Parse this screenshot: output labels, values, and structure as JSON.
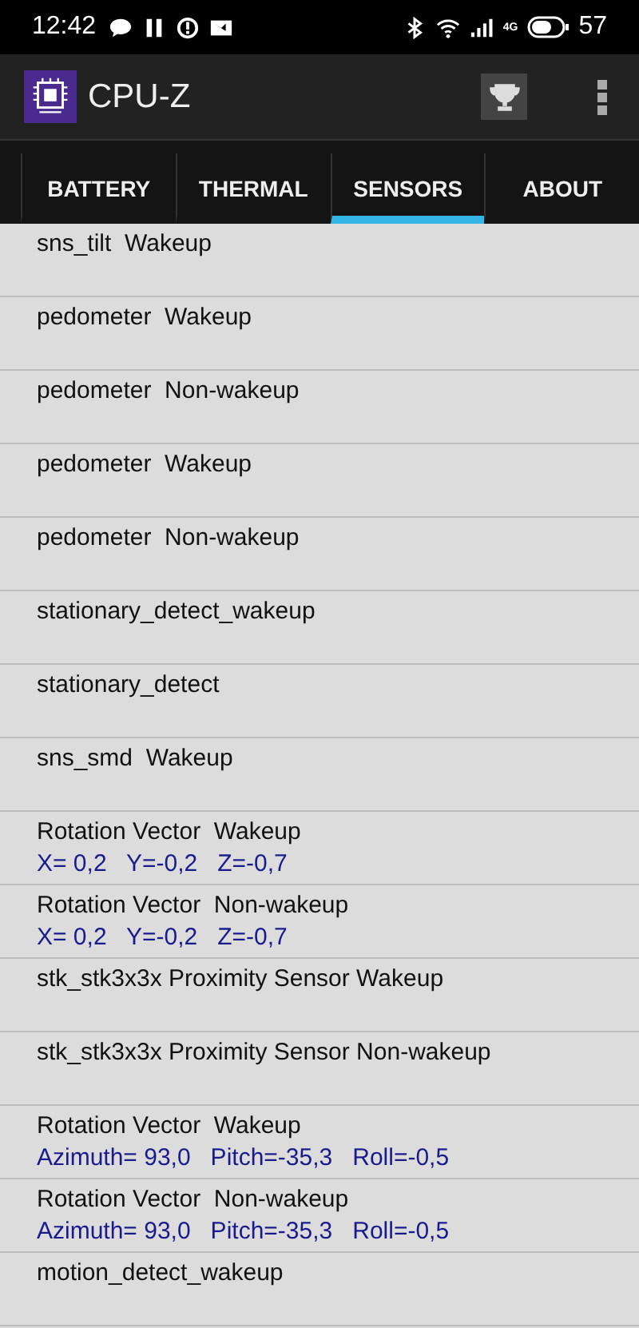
{
  "status_bar": {
    "time": "12:42",
    "battery": "57",
    "network": "4G"
  },
  "app_bar": {
    "title": "CPU-Z"
  },
  "tabs": [
    {
      "label": "BATTERY",
      "selected": false
    },
    {
      "label": "THERMAL",
      "selected": false
    },
    {
      "label": "SENSORS",
      "selected": true
    },
    {
      "label": "ABOUT",
      "selected": false
    }
  ],
  "sensors": [
    {
      "name": "sns_tilt  Wakeup"
    },
    {
      "name": "pedometer  Wakeup"
    },
    {
      "name": "pedometer  Non-wakeup"
    },
    {
      "name": "pedometer  Wakeup"
    },
    {
      "name": "pedometer  Non-wakeup"
    },
    {
      "name": "stationary_detect_wakeup"
    },
    {
      "name": "stationary_detect"
    },
    {
      "name": "sns_smd  Wakeup"
    },
    {
      "name": "Rotation Vector  Wakeup",
      "value": "X= 0,2   Y=-0,2   Z=-0,7"
    },
    {
      "name": "Rotation Vector  Non-wakeup",
      "value": "X= 0,2   Y=-0,2   Z=-0,7"
    },
    {
      "name": "stk_stk3x3x Proximity Sensor Wakeup"
    },
    {
      "name": "stk_stk3x3x Proximity Sensor Non-wakeup"
    },
    {
      "name": "Rotation Vector  Wakeup",
      "value": "Azimuth= 93,0   Pitch=-35,3   Roll=-0,5"
    },
    {
      "name": "Rotation Vector  Non-wakeup",
      "value": "Azimuth= 93,0   Pitch=-35,3   Roll=-0,5"
    },
    {
      "name": "motion_detect_wakeup"
    }
  ]
}
